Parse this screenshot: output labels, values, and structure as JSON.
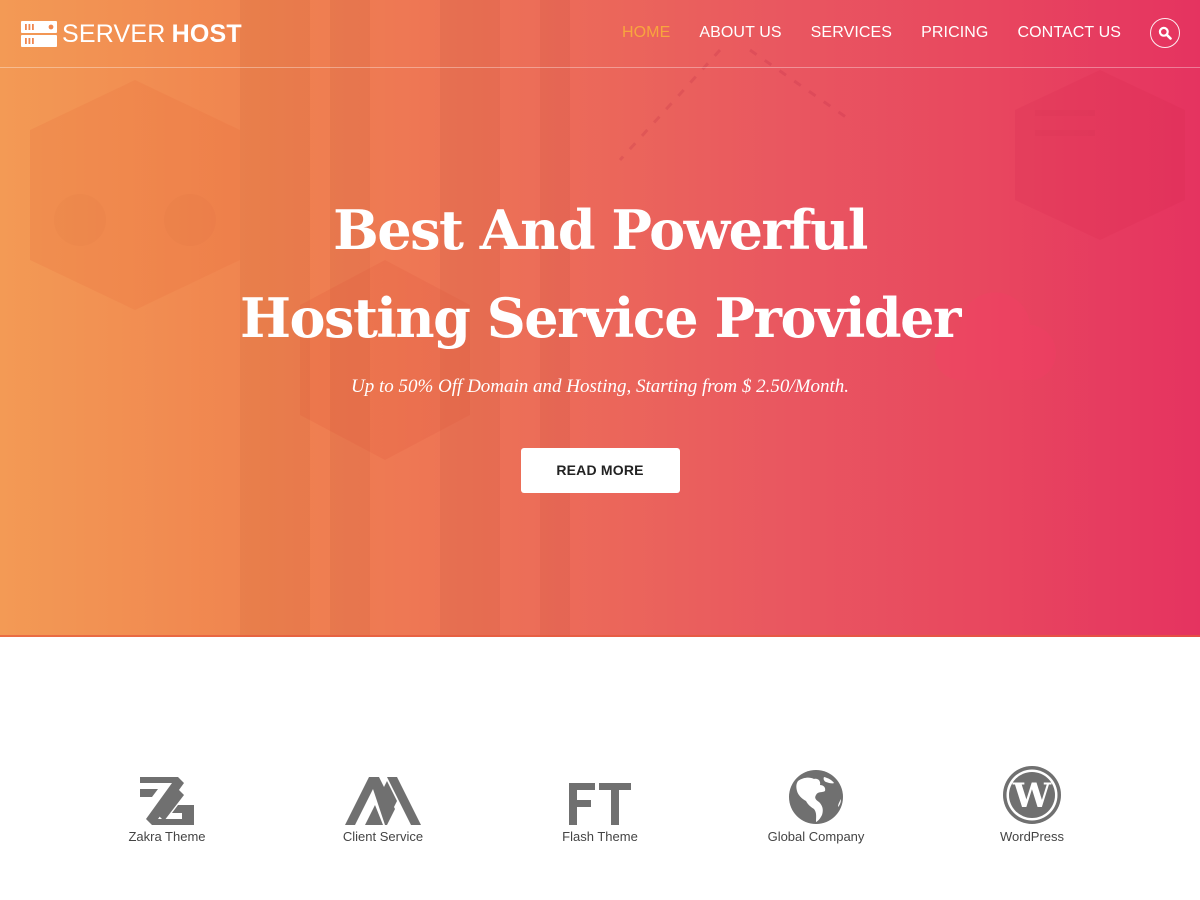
{
  "brand": {
    "name_light": "SERVER",
    "name_bold": "HOST",
    "icon": "server-icon"
  },
  "nav": {
    "items": [
      {
        "label": "HOME",
        "active": true
      },
      {
        "label": "ABOUT US",
        "active": false
      },
      {
        "label": "SERVICES",
        "active": false
      },
      {
        "label": "PRICING",
        "active": false
      },
      {
        "label": "CONTACT US",
        "active": false
      }
    ],
    "search_icon": "search-icon"
  },
  "hero": {
    "title": "Best And Powerful Hosting Service Provider",
    "subtitle": "Up to 50% Off Domain and Hosting, Starting from $ 2.50/Month.",
    "cta_label": "READ MORE"
  },
  "clients": [
    {
      "label": "Zakra Theme",
      "icon": "zakra-logo-icon"
    },
    {
      "label": "Client Service",
      "icon": "client-service-logo-icon"
    },
    {
      "label": "Flash Theme",
      "icon": "flash-theme-logo-icon"
    },
    {
      "label": "Global Company",
      "icon": "globe-icon"
    },
    {
      "label": "WordPress",
      "icon": "wordpress-icon"
    }
  ],
  "colors": {
    "nav_active": "#f8a53e",
    "hero_gradient_start": "#f39a55",
    "hero_gradient_end": "#e53360",
    "client_logo": "#707070"
  }
}
